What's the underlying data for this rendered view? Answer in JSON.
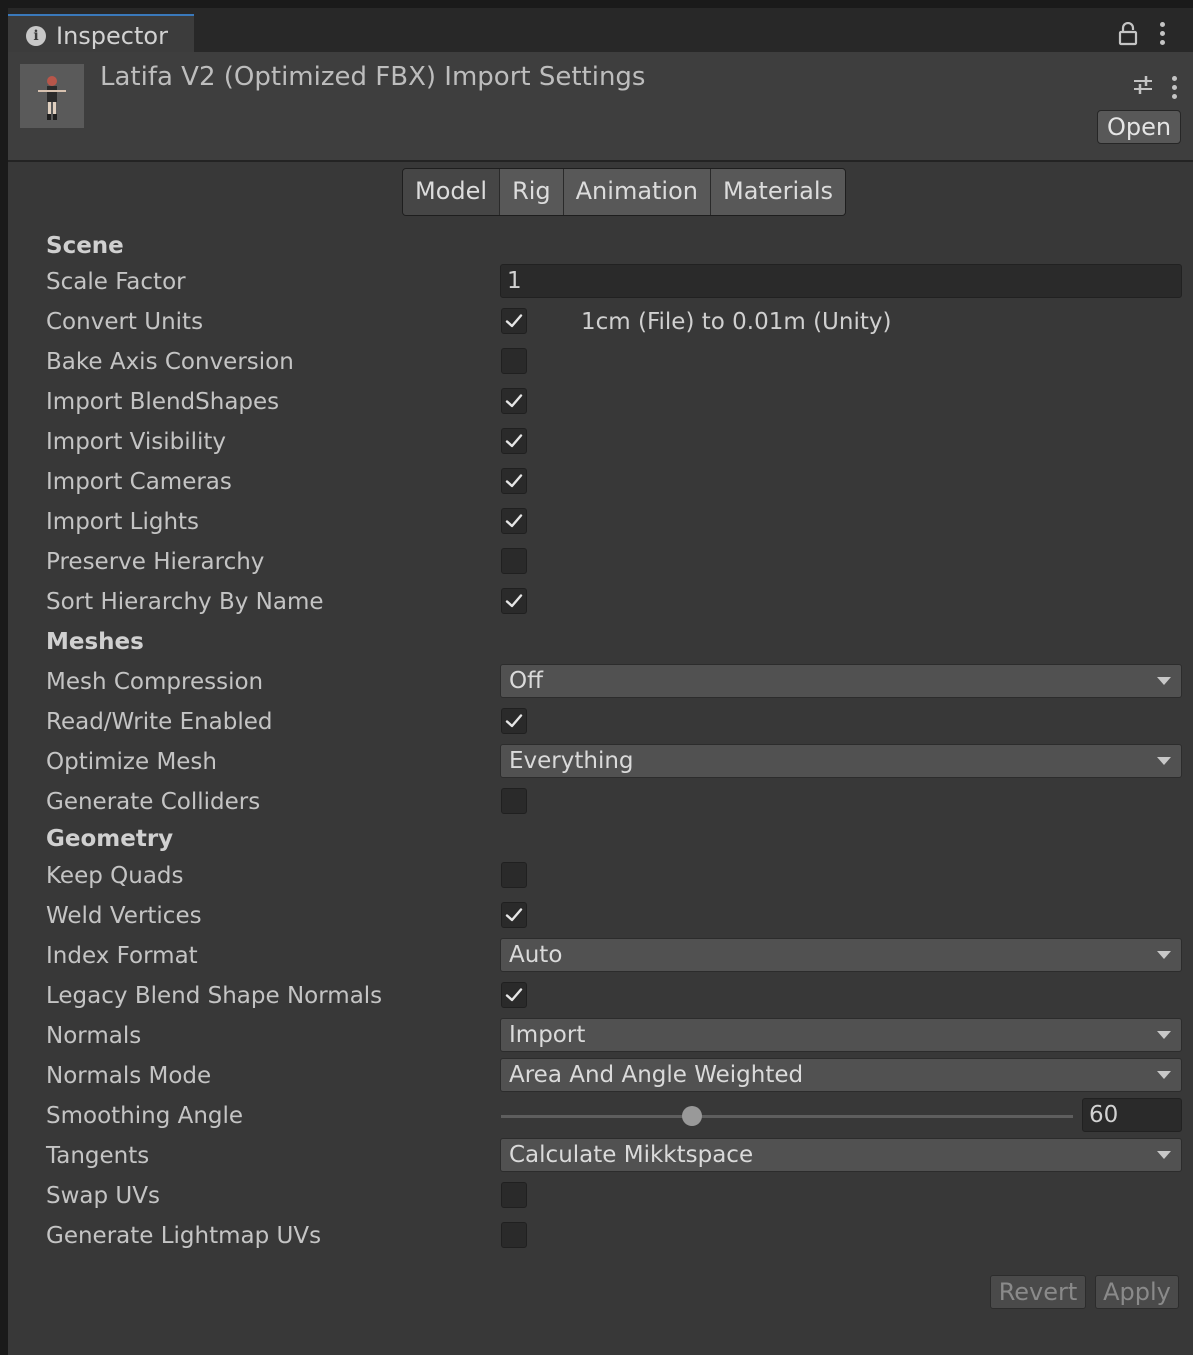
{
  "window": {
    "tab_label": "Inspector"
  },
  "header": {
    "title": "Latifa V2 (Optimized FBX) Import Settings",
    "open_label": "Open"
  },
  "tabs": [
    {
      "label": "Model",
      "active": true
    },
    {
      "label": "Rig",
      "active": false
    },
    {
      "label": "Animation",
      "active": false
    },
    {
      "label": "Materials",
      "active": false
    }
  ],
  "scene": {
    "heading": "Scene",
    "scale_factor": {
      "label": "Scale Factor",
      "value": "1"
    },
    "convert_units": {
      "label": "Convert Units",
      "checked": true,
      "note": "1cm (File) to 0.01m (Unity)"
    },
    "bake_axis_conversion": {
      "label": "Bake Axis Conversion",
      "checked": false
    },
    "import_blendshapes": {
      "label": "Import BlendShapes",
      "checked": true
    },
    "import_visibility": {
      "label": "Import Visibility",
      "checked": true
    },
    "import_cameras": {
      "label": "Import Cameras",
      "checked": true
    },
    "import_lights": {
      "label": "Import Lights",
      "checked": true
    },
    "preserve_hierarchy": {
      "label": "Preserve Hierarchy",
      "checked": false
    },
    "sort_hierarchy": {
      "label": "Sort Hierarchy By Name",
      "checked": true
    }
  },
  "meshes": {
    "heading": "Meshes",
    "mesh_compression": {
      "label": "Mesh Compression",
      "value": "Off"
    },
    "read_write": {
      "label": "Read/Write Enabled",
      "checked": true
    },
    "optimize_mesh": {
      "label": "Optimize Mesh",
      "value": "Everything"
    },
    "generate_colliders": {
      "label": "Generate Colliders",
      "checked": false
    }
  },
  "geometry": {
    "heading": "Geometry",
    "keep_quads": {
      "label": "Keep Quads",
      "checked": false
    },
    "weld_vertices": {
      "label": "Weld Vertices",
      "checked": true
    },
    "index_format": {
      "label": "Index Format",
      "value": "Auto"
    },
    "legacy_blend_shape_normals": {
      "label": "Legacy Blend Shape Normals",
      "checked": true
    },
    "normals": {
      "label": "Normals",
      "value": "Import"
    },
    "normals_mode": {
      "label": "Normals Mode",
      "value": "Area And Angle Weighted"
    },
    "smoothing_angle": {
      "label": "Smoothing Angle",
      "value": "60",
      "min": 0,
      "max": 180
    },
    "tangents": {
      "label": "Tangents",
      "value": "Calculate Mikktspace"
    },
    "swap_uvs": {
      "label": "Swap UVs",
      "checked": false
    },
    "generate_lightmap_uvs": {
      "label": "Generate Lightmap UVs",
      "checked": false
    }
  },
  "footer": {
    "revert_label": "Revert",
    "apply_label": "Apply"
  }
}
